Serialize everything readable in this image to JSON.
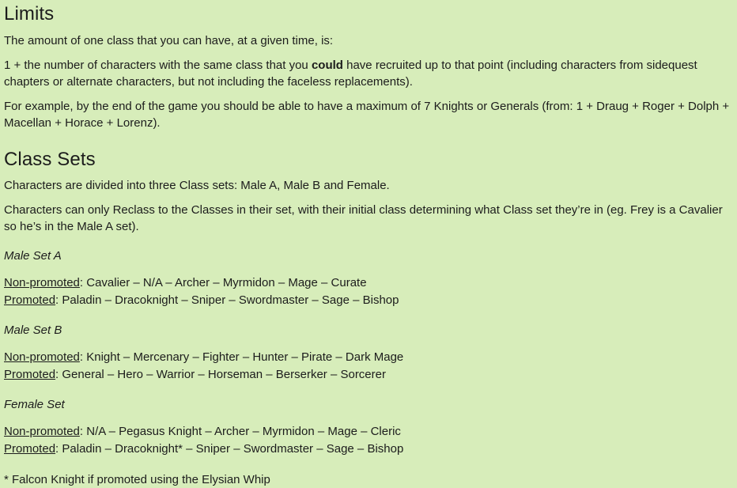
{
  "background_color": "#d7edba",
  "text_color": "#1c1c1c",
  "sections": {
    "limits": {
      "heading": "Limits",
      "intro": "The amount of one class that you can have, at a given time, is:",
      "rule_prefix": "1 + the number of characters with the same class that you ",
      "rule_bold": "could",
      "rule_suffix": " have recruited up to that point (including characters from sidequest chapters or alternate characters, but not including the faceless replacements).",
      "example": "For example, by the end of the game you should be able to have a maximum of 7 Knights or Generals (from: 1 + Draug + Roger + Dolph + Macellan + Horace + Lorenz)."
    },
    "class_sets": {
      "heading": "Class Sets",
      "intro": "Characters are divided into three Class sets: Male A, Male B and Female.",
      "reclass_rule": "Characters can only Reclass to the Classes in their set, with their initial class determining what Class set they’re in (eg. Frey is a Cavalier so he’s in the Male A set).",
      "labels": {
        "non_promoted": "Non-promoted",
        "promoted": "Promoted",
        "colon": ": "
      },
      "sets": [
        {
          "name": "Male Set A",
          "non_promoted": "Cavalier – N/A – Archer – Myrmidon – Mage – Curate",
          "promoted": "Paladin – Dracoknight – Sniper – Swordmaster – Sage – Bishop"
        },
        {
          "name": "Male Set B",
          "non_promoted": "Knight – Mercenary – Fighter – Hunter – Pirate – Dark Mage",
          "promoted": "General – Hero – Warrior – Horseman – Berserker – Sorcerer"
        },
        {
          "name": "Female Set",
          "non_promoted": "N/A – Pegasus Knight – Archer – Myrmidon – Mage – Cleric",
          "promoted": "Paladin – Dracoknight* – Sniper – Swordmaster – Sage – Bishop"
        }
      ],
      "footnote": "* Falcon Knight if promoted using the Elysian Whip"
    }
  }
}
